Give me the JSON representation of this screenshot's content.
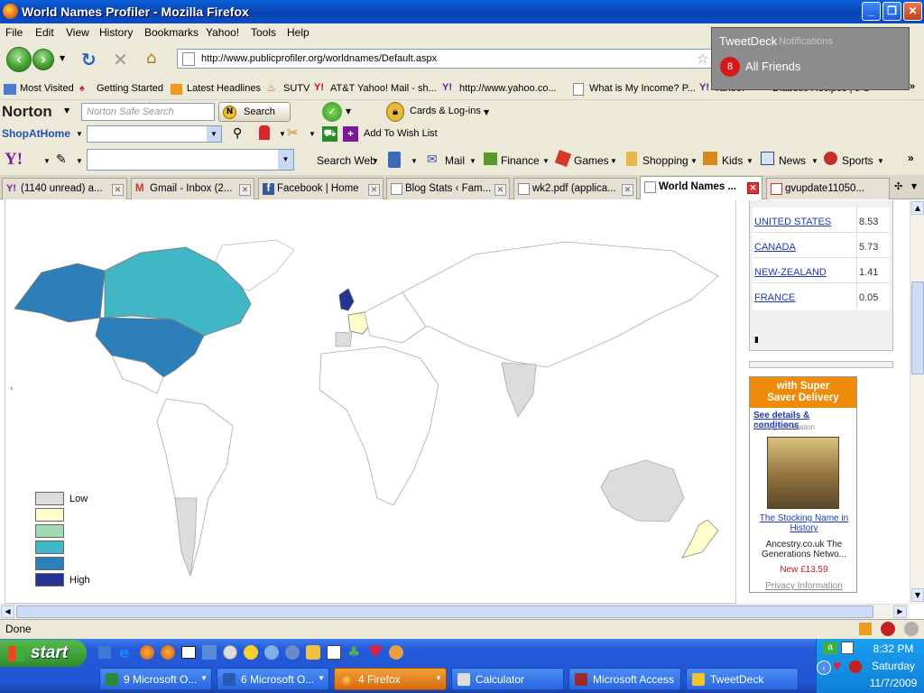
{
  "window": {
    "title": "World Names Profiler - Mozilla Firefox"
  },
  "menu": [
    "File",
    "Edit",
    "View",
    "History",
    "Bookmarks",
    "Yahoo!",
    "Tools",
    "Help"
  ],
  "address": {
    "url": "http://www.publicprofiler.org/worldnames/Default.aspx"
  },
  "bookmarks": [
    "Most Visited",
    "Getting Started",
    "Latest Headlines",
    "SUTV",
    "AT&T Yahoo! Mail - sh...",
    "http://www.yahoo.co...",
    "What is My Income? P...",
    "Yahoo!",
    "Diabetic Recipes | J C"
  ],
  "norton": {
    "logo": "Norton",
    "search_placeholder": "Norton Safe Search",
    "search_button": "Search",
    "cards_label": "Cards & Log-ins"
  },
  "shopathome": {
    "label": "ShopAtHome",
    "wishlist": "Add To Wish List"
  },
  "yahoo_toolbar": {
    "search_web": "Search Web",
    "mail": "Mail",
    "finance": "Finance",
    "games": "Games",
    "shopping": "Shopping",
    "kids": "Kids",
    "news": "News",
    "sports": "Sports"
  },
  "tabs": [
    "(1140 unread) a...",
    "Gmail - Inbox (2...",
    "Facebook | Home",
    "Blog Stats ‹ Fam...",
    "wk2.pdf (applica...",
    "World Names ...",
    "gvupdate11050..."
  ],
  "countries": [
    {
      "name": "UNITED STATES",
      "value": "8.53"
    },
    {
      "name": "CANADA",
      "value": "5.73"
    },
    {
      "name": "NEW-ZEALAND",
      "value": "1.41"
    },
    {
      "name": "FRANCE",
      "value": "0.05"
    }
  ],
  "legend": {
    "low": "Low",
    "high": "High",
    "colors": [
      "#dcdcdc",
      "#ffffcc",
      "#a1dab4",
      "#41b6c4",
      "#2c7fb8",
      "#253494"
    ]
  },
  "ad": {
    "headline1": "with Super",
    "headline2": "Saver Delivery",
    "details": "See details & conditions",
    "privacy": "Privacy information",
    "book_title": "The Stocking Name in History",
    "seller": "Ancestry.co.uk The Generations Netwo...",
    "price": "New £13.59",
    "privacy_link": "Privacy Information"
  },
  "status": {
    "text": "Done"
  },
  "tweetdeck": {
    "app": "TweetDeck",
    "sub": "Notifications",
    "count": "8",
    "label": "All Friends"
  },
  "taskbar": {
    "start": "start",
    "tasks": [
      "9 Microsoft O...",
      "6 Microsoft O...",
      "4 Firefox",
      "Calculator",
      "Microsoft Access",
      "TweetDeck"
    ],
    "time": "8:32 PM",
    "day": "Saturday",
    "date": "11/7/2009"
  }
}
